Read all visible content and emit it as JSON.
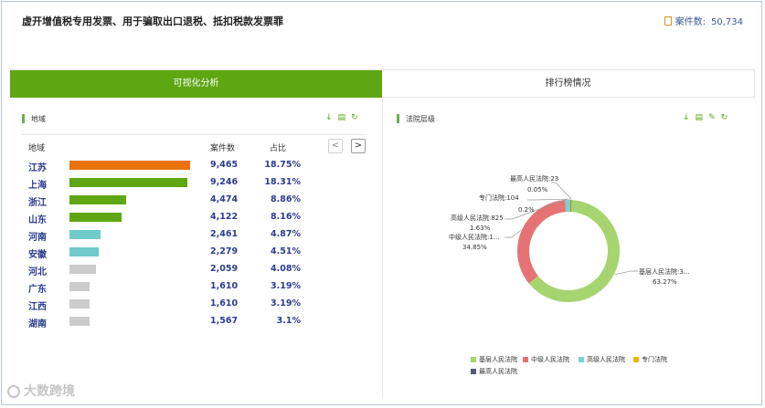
{
  "page": {
    "title": "虚开增值税专用发票、用于骗取出口退税、抵扣税款发票罪",
    "case_label": "案件数:",
    "case_value": "50,734"
  },
  "tabs": [
    {
      "label": "可视化分析",
      "active": true
    },
    {
      "label": "排行榜情况",
      "active": false
    }
  ],
  "left_panel": {
    "title": "地域",
    "columns": {
      "region": "地域",
      "count": "案件数",
      "pct": "占比"
    },
    "pager": {
      "prev": "<",
      "next": ">"
    },
    "rows": [
      {
        "region": "江苏",
        "count": "9,465",
        "pct": "18.75%",
        "value": 9465,
        "color": "#e8720c"
      },
      {
        "region": "上海",
        "count": "9,246",
        "pct": "18.31%",
        "value": 9246,
        "color": "#5ea712"
      },
      {
        "region": "浙江",
        "count": "4,474",
        "pct": "8.86%",
        "value": 4474,
        "color": "#5ea712"
      },
      {
        "region": "山东",
        "count": "4,122",
        "pct": "8.16%",
        "value": 4122,
        "color": "#5ea712"
      },
      {
        "region": "河南",
        "count": "2,461",
        "pct": "4.87%",
        "value": 2461,
        "color": "#6ecbca"
      },
      {
        "region": "安徽",
        "count": "2,279",
        "pct": "4.51%",
        "value": 2279,
        "color": "#6ecbca"
      },
      {
        "region": "河北",
        "count": "2,059",
        "pct": "4.08%",
        "value": 2059,
        "color": "#cccccc"
      },
      {
        "region": "广东",
        "count": "1,610",
        "pct": "3.19%",
        "value": 1610,
        "color": "#cccccc"
      },
      {
        "region": "江西",
        "count": "1,610",
        "pct": "3.19%",
        "value": 1610,
        "color": "#cccccc"
      },
      {
        "region": "湖南",
        "count": "1,567",
        "pct": "3.1%",
        "value": 1567,
        "color": "#cccccc"
      }
    ]
  },
  "right_panel": {
    "title": "法院层级"
  },
  "chart_data": {
    "type": "pie",
    "donut": true,
    "slices": [
      {
        "name": "基层人民法院",
        "label": "基层人民法院:3...",
        "pct": "63.27%",
        "value": 63.27,
        "color": "#a6d46f"
      },
      {
        "name": "中级人民法院",
        "label": "中级人民法院:1...",
        "pct": "34.85%",
        "value": 34.85,
        "color": "#e57373"
      },
      {
        "name": "高级人民法院",
        "label": "高级人民法院:825",
        "pct": "1.63%",
        "value": 1.63,
        "color": "#7ecfd0"
      },
      {
        "name": "专门法院",
        "label": "专门法院:104",
        "pct": "0.2%",
        "value": 0.2,
        "color": "#f0b400"
      },
      {
        "name": "最高人民法院",
        "label": "最高人民法院:23",
        "pct": "0.05%",
        "value": 0.05,
        "color": "#555a70"
      }
    ]
  },
  "watermark": "大数跨境"
}
